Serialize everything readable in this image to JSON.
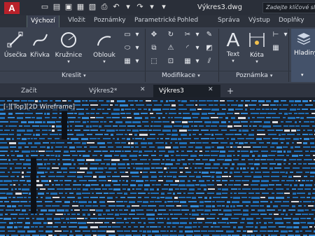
{
  "app": {
    "logo_letter": "A",
    "title": "Výkres3.dwg"
  },
  "search": {
    "placeholder": "Zadejte klíčové slo"
  },
  "ribbon_tabs": [
    "Výchozí",
    "Vložit",
    "Poznámky",
    "Parametrické",
    "Pohled",
    "Správa",
    "Výstup",
    "Doplňky"
  ],
  "ribbon": {
    "draw_panel": {
      "tools": [
        "Úsečka",
        "Křivka",
        "Kružnice",
        "Oblouk"
      ],
      "title": "Kreslit"
    },
    "modify_panel": {
      "title": "Modifikace"
    },
    "annotation_panel": {
      "tools": [
        "Text",
        "Kóta"
      ],
      "title": "Poznámka"
    },
    "layers": {
      "label": "Hladiny"
    }
  },
  "doc_tabs": [
    {
      "label": "Začít"
    },
    {
      "label": "Výkres2*"
    },
    {
      "label": "Výkres3"
    }
  ],
  "viewport": {
    "label": "[-][Top][2D Wireframe]"
  },
  "colors": {
    "accent": "#2f88d6",
    "ribbon_bg": "#3b4250",
    "canvas_bg": "#1c212b"
  }
}
